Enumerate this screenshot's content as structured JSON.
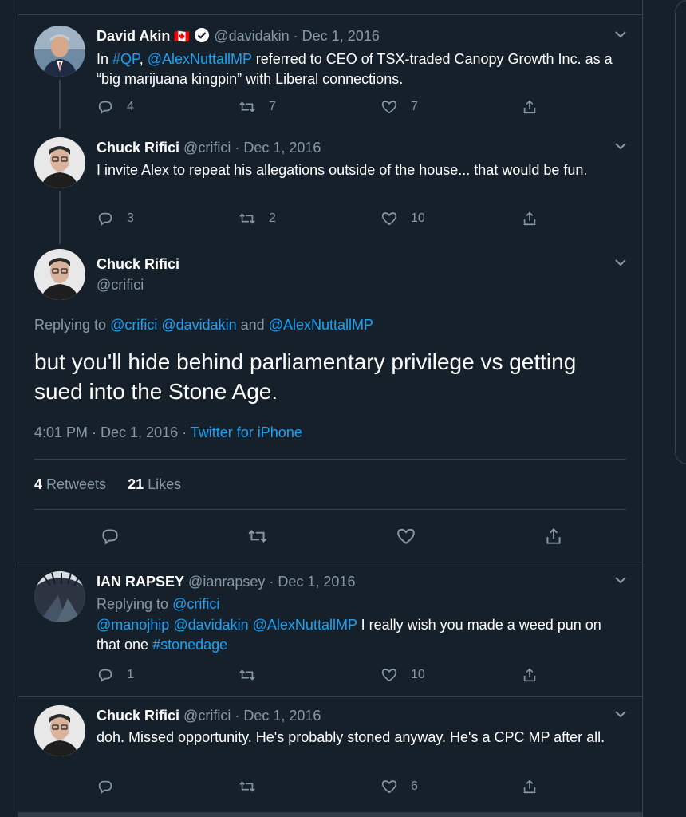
{
  "colors": {
    "background": "#15202b",
    "border": "#38444d",
    "muted": "#8899a6",
    "accent": "#1da1f2",
    "text": "#ffffff"
  },
  "tweets": [
    {
      "name": "David Akin",
      "flag": "🇨🇦",
      "handle": "@davidakin",
      "date": "· Dec 1, 2016",
      "text_parts": {
        "a": "In ",
        "tag": "#QP",
        "b": ", ",
        "mention": "@AlexNuttallMP",
        "c": " referred to CEO of TSX-traded Canopy Growth Inc. as a “big marijuana kingpin” with Liberal connections."
      },
      "replies": "4",
      "retweets": "7",
      "likes": "7"
    },
    {
      "name": "Chuck Rifici",
      "handle": "@crifici",
      "date": "· Dec 1, 2016",
      "text": "I invite Alex to repeat his allegations outside of the house... that would be fun.",
      "replies": "3",
      "retweets": "2",
      "likes": "10"
    }
  ],
  "main": {
    "name": "Chuck Rifici",
    "handle": "@crifici",
    "replying_prefix": "Replying to ",
    "replying_1": "@crifici",
    "replying_2": " @davidakin",
    "replying_and": " and ",
    "replying_3": "@AlexNuttallMP",
    "text": "but you'll hide behind parliamentary privilege vs getting sued into the Stone Age.",
    "time": "4:01 PM · Dec 1, 2016 · ",
    "source": "Twitter for iPhone",
    "retweets_count": "4",
    "retweets_label": " Retweets",
    "likes_count": "21",
    "likes_label": " Likes"
  },
  "replies": [
    {
      "name": "IAN RAPSEY",
      "handle": "@ianrapsey",
      "date": "· Dec 1, 2016",
      "replying_prefix": "Replying to ",
      "replying_to": "@crifici",
      "mentions": "@manojhip @davidakin @AlexNuttallMP",
      "text": " I really wish you made a weed pun on that one ",
      "hashtag": "#stonedage",
      "replies": "1",
      "retweets": "",
      "likes": "10"
    },
    {
      "name": "Chuck Rifici",
      "handle": "@crifici",
      "date": "· Dec 1, 2016",
      "text": "doh. Missed opportunity. He's probably stoned anyway. He's a CPC MP after all.",
      "replies": "",
      "retweets": "",
      "likes": "6"
    }
  ]
}
